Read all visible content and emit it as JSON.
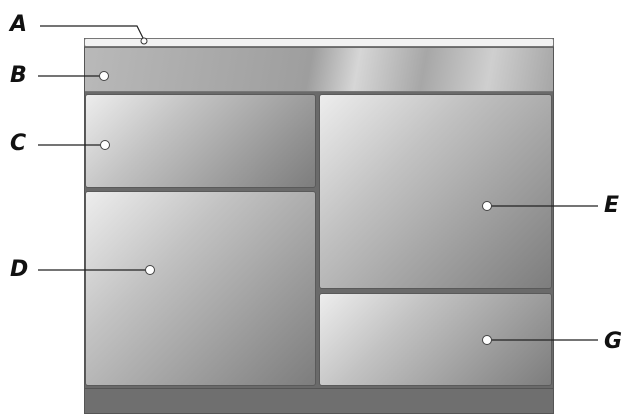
{
  "labels": {
    "a": "A",
    "b": "B",
    "c": "C",
    "d": "D",
    "e": "E",
    "g": "G"
  }
}
